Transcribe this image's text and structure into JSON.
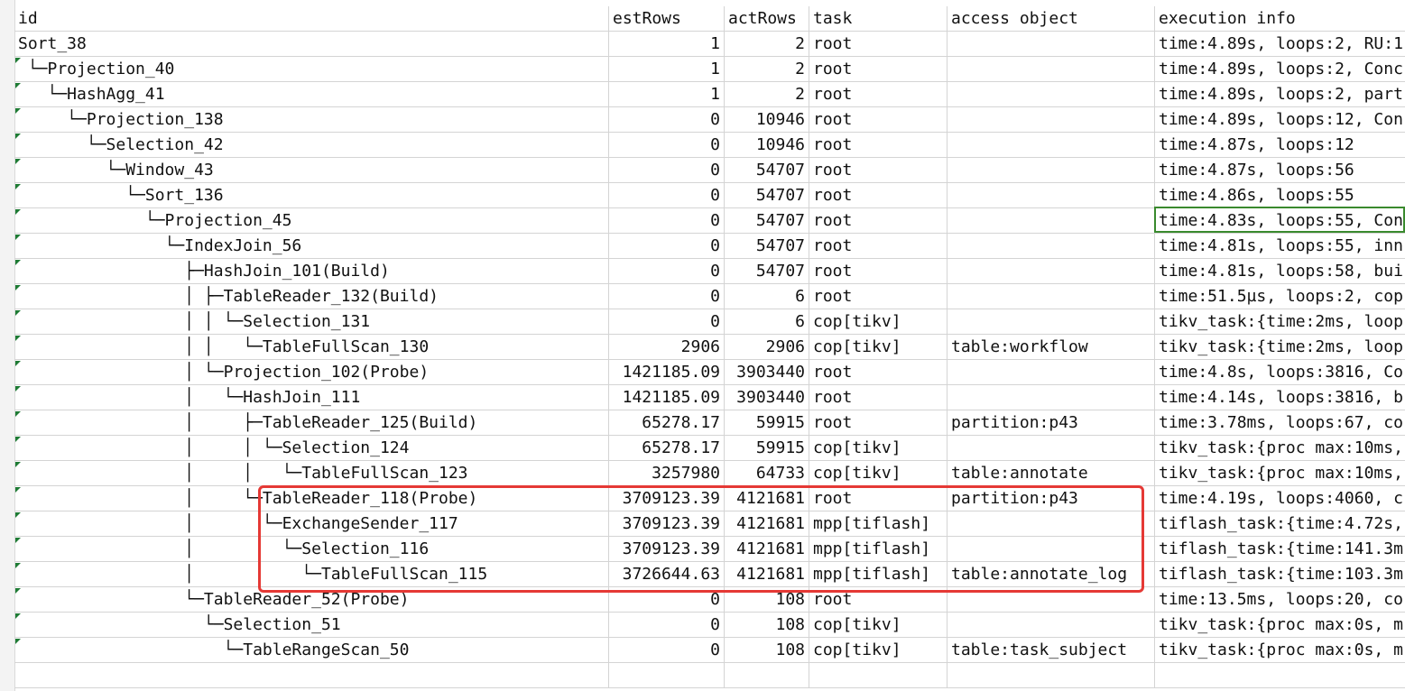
{
  "highlight_color": "#e53935",
  "selection_color": "#3a8a2e",
  "columns": [
    "id",
    "estRows",
    "actRows",
    "task",
    "access object",
    "execution info"
  ],
  "rows": [
    {
      "id": "Sort_38",
      "estRows": "1",
      "actRows": "2",
      "task": "root",
      "access": "",
      "info": "time:4.89s, loops:2, RU:1"
    },
    {
      "id": " └─Projection_40",
      "estRows": "1",
      "actRows": "2",
      "task": "root",
      "access": "",
      "info": "time:4.89s, loops:2, Conc"
    },
    {
      "id": "   └─HashAgg_41",
      "estRows": "1",
      "actRows": "2",
      "task": "root",
      "access": "",
      "info": "time:4.89s, loops:2, part"
    },
    {
      "id": "     └─Projection_138",
      "estRows": "0",
      "actRows": "10946",
      "task": "root",
      "access": "",
      "info": "time:4.89s, loops:12, Con"
    },
    {
      "id": "       └─Selection_42",
      "estRows": "0",
      "actRows": "10946",
      "task": "root",
      "access": "",
      "info": "time:4.87s, loops:12"
    },
    {
      "id": "         └─Window_43",
      "estRows": "0",
      "actRows": "54707",
      "task": "root",
      "access": "",
      "info": "time:4.87s, loops:56"
    },
    {
      "id": "           └─Sort_136",
      "estRows": "0",
      "actRows": "54707",
      "task": "root",
      "access": "",
      "info": "time:4.86s, loops:55"
    },
    {
      "id": "             └─Projection_45",
      "estRows": "0",
      "actRows": "54707",
      "task": "root",
      "access": "",
      "info": "time:4.83s, loops:55, Con"
    },
    {
      "id": "               └─IndexJoin_56",
      "estRows": "0",
      "actRows": "54707",
      "task": "root",
      "access": "",
      "info": "time:4.81s, loops:55, inn"
    },
    {
      "id": "                 ├─HashJoin_101(Build)",
      "estRows": "0",
      "actRows": "54707",
      "task": "root",
      "access": "",
      "info": "time:4.81s, loops:58, bui"
    },
    {
      "id": "                 │ ├─TableReader_132(Build)",
      "estRows": "0",
      "actRows": "6",
      "task": "root",
      "access": "",
      "info": "time:51.5µs, loops:2, cop"
    },
    {
      "id": "                 │ │ └─Selection_131",
      "estRows": "0",
      "actRows": "6",
      "task": "cop[tikv]",
      "access": "",
      "info": "tikv_task:{time:2ms, loop"
    },
    {
      "id": "                 │ │   └─TableFullScan_130",
      "estRows": "2906",
      "actRows": "2906",
      "task": "cop[tikv]",
      "access": "table:workflow",
      "info": "tikv_task:{time:2ms, loop"
    },
    {
      "id": "                 │ └─Projection_102(Probe)",
      "estRows": "1421185.09",
      "actRows": "3903440",
      "task": "root",
      "access": "",
      "info": "time:4.8s, loops:3816, Co"
    },
    {
      "id": "                 │   └─HashJoin_111",
      "estRows": "1421185.09",
      "actRows": "3903440",
      "task": "root",
      "access": "",
      "info": "time:4.14s, loops:3816, b"
    },
    {
      "id": "                 │     ├─TableReader_125(Build)",
      "estRows": "65278.17",
      "actRows": "59915",
      "task": "root",
      "access": "partition:p43",
      "info": "time:3.78ms, loops:67, co"
    },
    {
      "id": "                 │     │ └─Selection_124",
      "estRows": "65278.17",
      "actRows": "59915",
      "task": "cop[tikv]",
      "access": "",
      "info": "tikv_task:{proc max:10ms,"
    },
    {
      "id": "                 │     │   └─TableFullScan_123",
      "estRows": "3257980",
      "actRows": "64733",
      "task": "cop[tikv]",
      "access": "table:annotate",
      "info": "tikv_task:{proc max:10ms,"
    },
    {
      "id": "                 │     └─TableReader_118(Probe)",
      "estRows": "3709123.39",
      "actRows": "4121681",
      "task": "root",
      "access": "partition:p43",
      "info": "time:4.19s, loops:4060, c"
    },
    {
      "id": "                 │       └─ExchangeSender_117",
      "estRows": "3709123.39",
      "actRows": "4121681",
      "task": "mpp[tiflash]",
      "access": "",
      "info": "tiflash_task:{time:4.72s,"
    },
    {
      "id": "                 │         └─Selection_116",
      "estRows": "3709123.39",
      "actRows": "4121681",
      "task": "mpp[tiflash]",
      "access": "",
      "info": "tiflash_task:{time:141.3m"
    },
    {
      "id": "                 │           └─TableFullScan_115",
      "estRows": "3726644.63",
      "actRows": "4121681",
      "task": "mpp[tiflash]",
      "access": "table:annotate_log",
      "info": "tiflash_task:{time:103.3m"
    },
    {
      "id": "                 └─TableReader_52(Probe)",
      "estRows": "0",
      "actRows": "108",
      "task": "root",
      "access": "",
      "info": "time:13.5ms, loops:20, co"
    },
    {
      "id": "                   └─Selection_51",
      "estRows": "0",
      "actRows": "108",
      "task": "cop[tikv]",
      "access": "",
      "info": "tikv_task:{proc max:0s, m"
    },
    {
      "id": "                     └─TableRangeScan_50",
      "estRows": "0",
      "actRows": "108",
      "task": "cop[tikv]",
      "access": "table:task_subject",
      "info": "tikv_task:{proc max:0s, m"
    },
    {
      "id": "",
      "estRows": "",
      "actRows": "",
      "task": "",
      "access": "",
      "info": ""
    }
  ]
}
